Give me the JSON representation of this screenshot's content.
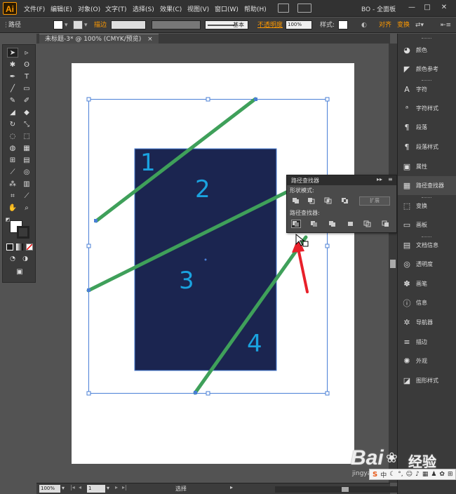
{
  "app": {
    "logo": "Ai",
    "menus": [
      "文件(F)",
      "编辑(E)",
      "对象(O)",
      "文字(T)",
      "选择(S)",
      "效果(C)",
      "视图(V)",
      "窗口(W)",
      "帮助(H)"
    ],
    "workspace": "BO - 全面板",
    "window_buttons": [
      "—",
      "□",
      "✕"
    ]
  },
  "control_bar": {
    "mode_label": "路径",
    "stroke_label": "描边",
    "profile_label": "基本",
    "opacity_label": "不透明度",
    "opacity_value": "100%",
    "style_label": "样式:",
    "align_label": "对齐",
    "transform_label": "变换"
  },
  "document": {
    "tab_title": "未标题-3* @ 100% (CMYK/预览)",
    "tab_close": "×"
  },
  "canvas": {
    "region_numbers": [
      "1",
      "2",
      "3",
      "4"
    ],
    "rect_fill": "#1b2550",
    "line_color": "#3fa05a",
    "number_color": "#1aa3e0"
  },
  "status_bar": {
    "zoom": "100%",
    "page": "1",
    "tool": "选择"
  },
  "pathfinder": {
    "title": "路径查找器",
    "shape_modes_label": "形状模式:",
    "pathfinders_label": "路径查找器:",
    "expand_label": "扩展"
  },
  "dock": {
    "items": [
      "颜色",
      "颜色参考",
      "字符",
      "字符样式",
      "段落",
      "段落样式",
      "属性",
      "路径查找器",
      "变换",
      "画板",
      "文档信息",
      "透明度",
      "画笔",
      "信息",
      "导航器",
      "描边",
      "外观",
      "图形样式"
    ]
  },
  "watermark": {
    "brand": "Bai",
    "brand_cn": "经验",
    "url": "jingyan.baidu.com",
    "ime": "中"
  }
}
